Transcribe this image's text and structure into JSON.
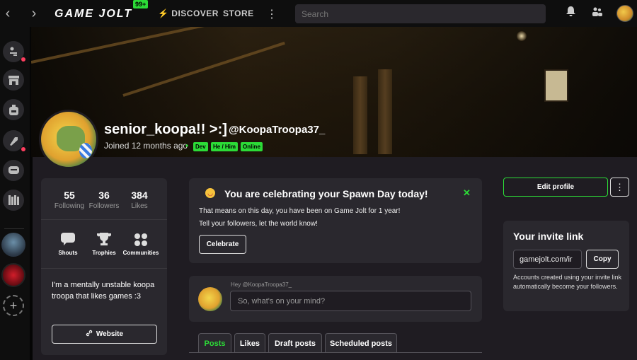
{
  "topbar": {
    "logo": "GAME JOLT",
    "notification_badge": "99+",
    "nav_discover": "DISCOVER",
    "nav_store": "STORE",
    "search_placeholder": "Search",
    "more_glyph": "⋮",
    "discover_glyph": "⚡"
  },
  "sidebar": {
    "icons": [
      "activity-icon",
      "store-icon",
      "backpack-icon",
      "quests-icon",
      "chat-icon",
      "library-icon"
    ],
    "add_glyph": "+"
  },
  "profile": {
    "display_name": "senior_koopa!! >:]",
    "username": "@KoopaTroopa37_",
    "joined": "Joined 12 months ago",
    "dot": "•",
    "tags": [
      "Dev",
      "He / Him",
      "Online"
    ]
  },
  "stats": [
    {
      "value": "55",
      "label": "Following"
    },
    {
      "value": "36",
      "label": "Followers"
    },
    {
      "value": "384",
      "label": "Likes"
    }
  ],
  "features": [
    {
      "label": "Shouts",
      "icon": "shouts-icon"
    },
    {
      "label": "Trophies",
      "icon": "trophy-icon"
    },
    {
      "label": "Communities",
      "icon": "communities-icon"
    }
  ],
  "bio": "I'm a mentally unstable koopa troopa that likes games  :3",
  "website_label": "Website",
  "spawn_day": {
    "title": "You are celebrating your Spawn Day today!",
    "line1": "That means on this day, you have been on Game Jolt for 1 year!",
    "line2": "Tell your followers, let the world know!",
    "button": "Celebrate",
    "close": "✕"
  },
  "composer": {
    "hey": "Hey @KoopaTroopa37_",
    "placeholder": "So, what's on your mind?"
  },
  "tabs": [
    "Posts",
    "Likes",
    "Draft posts",
    "Scheduled posts"
  ],
  "actions": {
    "edit_profile": "Edit profile",
    "more": "⋮"
  },
  "invite": {
    "title": "Your invite link",
    "link": "gamejolt.com/ir",
    "copy": "Copy",
    "description": "Accounts created using your invite link automatically become your followers."
  },
  "colors": {
    "accent": "#2cdb37",
    "notification": "#ff3e5f",
    "background": "#1f1c22",
    "card": "#2a282e"
  }
}
